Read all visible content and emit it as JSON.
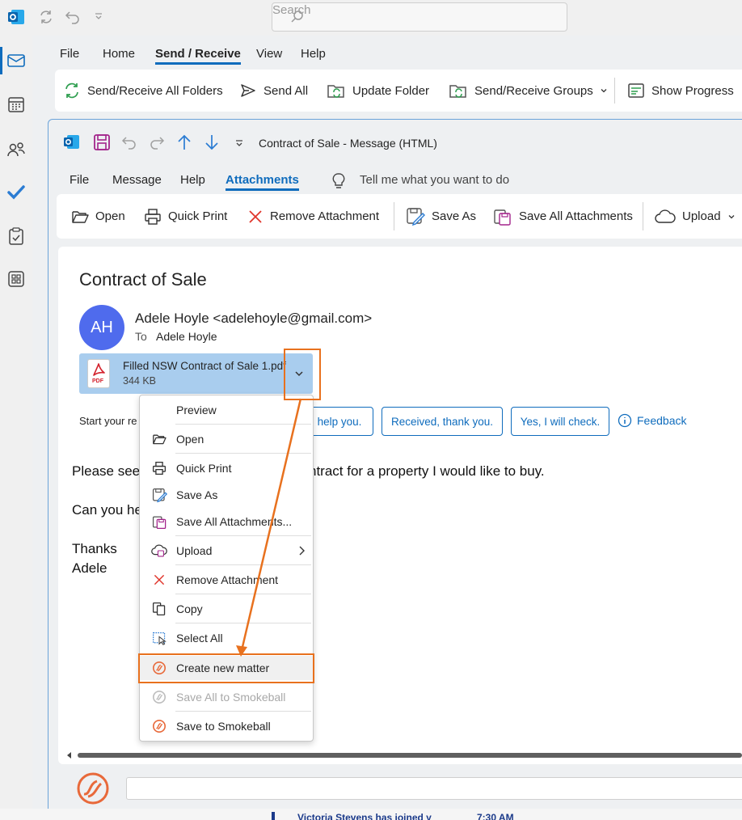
{
  "title_bar": {
    "search_placeholder": "Search"
  },
  "outer_tabs": [
    "File",
    "Home",
    "Send / Receive",
    "View",
    "Help"
  ],
  "outer_active_tab": "Send / Receive",
  "outer_ribbon": {
    "send_receive_all": "Send/Receive All Folders",
    "send_all": "Send All",
    "update_folder": "Update Folder",
    "send_receive_groups": "Send/Receive Groups",
    "show_progress": "Show Progress"
  },
  "message_window": {
    "title": "Contract of Sale  -  Message (HTML)",
    "tabs": [
      "File",
      "Message",
      "Help",
      "Attachments"
    ],
    "active_tab": "Attachments",
    "tell_me": "Tell me what you want to do",
    "ribbon": {
      "open": "Open",
      "quick_print": "Quick Print",
      "remove_attachment": "Remove Attachment",
      "save_as": "Save As",
      "save_all_attachments": "Save All Attachments",
      "upload": "Upload"
    }
  },
  "email": {
    "subject": "Contract of Sale",
    "avatar_initials": "AH",
    "sender": "Adele Hoyle <adelehoyle@gmail.com>",
    "to_label": "To",
    "to_name": "Adele Hoyle",
    "attachment": {
      "name": "Filled NSW Contract of Sale 1.pdf",
      "size": "344 KB",
      "icon_label": "PDF"
    },
    "suggested_prefix": "Start your re",
    "suggested_replies": [
      "help you.",
      "Received, thank you.",
      "Yes, I will check."
    ],
    "feedback": "Feedback",
    "body": {
      "line1a": "Please see",
      "line1b": "ntract for a property I would like to buy.",
      "line2": "Can you he",
      "line3": "Thanks",
      "line4": "Adele"
    }
  },
  "context_menu": [
    {
      "label": "Preview",
      "icon": "none",
      "disabled": false
    },
    {
      "label": "Open",
      "icon": "folder-open-icon",
      "disabled": false
    },
    {
      "label": "Quick Print",
      "icon": "printer-icon",
      "disabled": false
    },
    {
      "label": "Save As",
      "icon": "save-as-icon",
      "disabled": false
    },
    {
      "label": "Save All Attachments...",
      "icon": "save-all-icon",
      "disabled": false
    },
    {
      "label": "Upload",
      "icon": "cloud-upload-icon",
      "disabled": false,
      "submenu": true
    },
    {
      "label": "Remove Attachment",
      "icon": "remove-x-icon",
      "disabled": false
    },
    {
      "label": "Copy",
      "icon": "copy-icon",
      "disabled": false
    },
    {
      "label": "Select All",
      "icon": "select-all-icon",
      "disabled": false
    },
    {
      "label": "Create new matter",
      "icon": "smokeball-icon",
      "disabled": false,
      "highlighted": true
    },
    {
      "label": "Save All to Smokeball",
      "icon": "smokeball-icon",
      "disabled": true
    },
    {
      "label": "Save to Smokeball",
      "icon": "smokeball-icon",
      "disabled": false
    }
  ],
  "behind_window": {
    "notification": "Victoria Stevens has joined y",
    "time": "7:30 AM"
  },
  "colors": {
    "accent_blue": "#0f6cbd",
    "annotation_orange": "#e8711e",
    "smokeball_orange": "#e8693a",
    "avatar_blue": "#4f6bed",
    "attachment_bg": "#a9cdee"
  }
}
